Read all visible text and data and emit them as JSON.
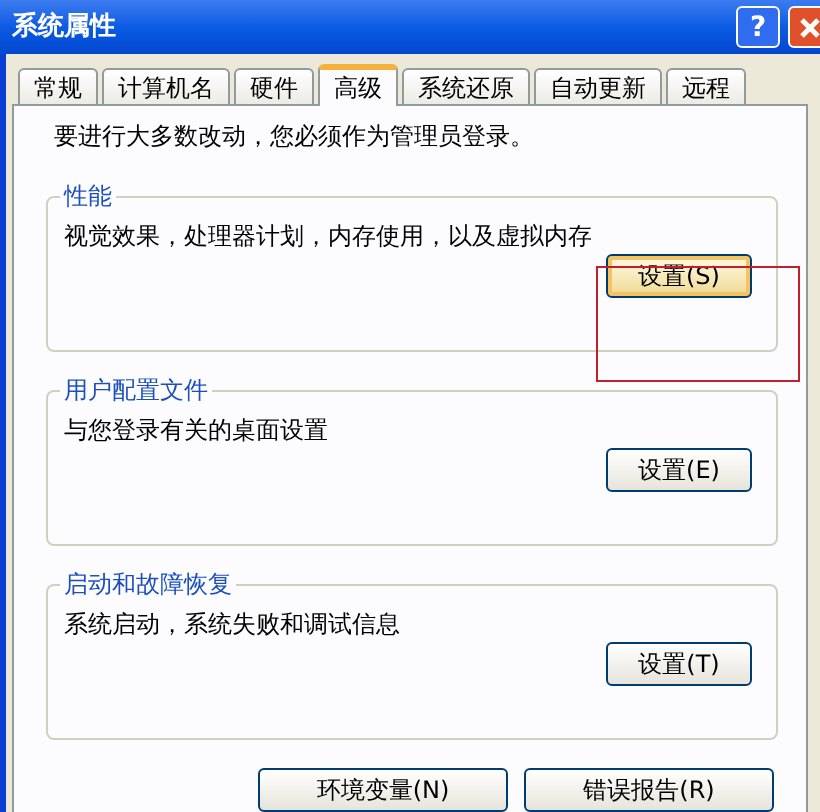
{
  "window": {
    "title": "系统属性",
    "help_button": "?"
  },
  "tabs": [
    {
      "label": "常规",
      "selected": false
    },
    {
      "label": "计算机名",
      "selected": false
    },
    {
      "label": "硬件",
      "selected": false
    },
    {
      "label": "高级",
      "selected": true
    },
    {
      "label": "系统还原",
      "selected": false
    },
    {
      "label": "自动更新",
      "selected": false
    },
    {
      "label": "远程",
      "selected": false
    }
  ],
  "notice": "要进行大多数改动，您必须作为管理员登录。",
  "groups": [
    {
      "title": "性能",
      "description": "视觉效果，处理器计划，内存使用，以及虚拟内存",
      "button": "设置(S)",
      "focused": true,
      "highlighted": true
    },
    {
      "title": "用户配置文件",
      "description": "与您登录有关的桌面设置",
      "button": "设置(E)",
      "focused": false,
      "highlighted": false
    },
    {
      "title": "启动和故障恢复",
      "description": "系统启动，系统失败和调试信息",
      "button": "设置(T)",
      "focused": false,
      "highlighted": false
    }
  ],
  "bottom_buttons": [
    "环境变量(N)",
    "错误报告(R)"
  ]
}
